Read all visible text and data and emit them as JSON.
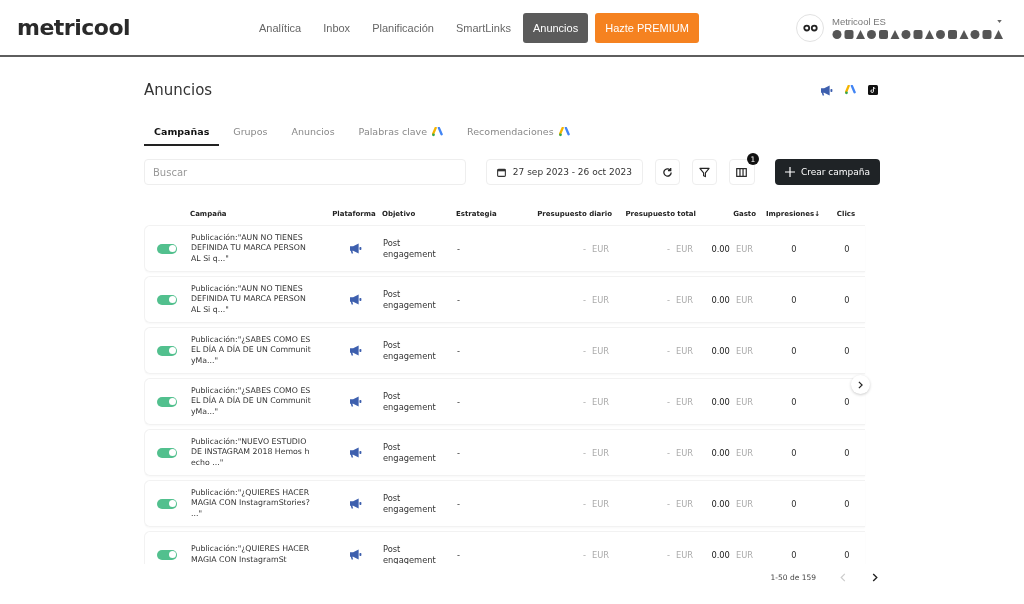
{
  "header": {
    "logo": "metricool",
    "nav": [
      {
        "label": "Analítica",
        "selected": false
      },
      {
        "label": "Inbox",
        "selected": false
      },
      {
        "label": "Planificación",
        "selected": false
      },
      {
        "label": "SmartLinks",
        "selected": false
      },
      {
        "label": "Anuncios",
        "selected": true
      }
    ],
    "premium": "Hazte PREMIUM",
    "account": {
      "name": "Metricool ES"
    }
  },
  "page": {
    "title": "Anuncios"
  },
  "tabs": [
    {
      "label": "Campañas",
      "selected": true,
      "ads_icon": false
    },
    {
      "label": "Grupos",
      "selected": false,
      "ads_icon": false
    },
    {
      "label": "Anuncios",
      "selected": false,
      "ads_icon": false
    },
    {
      "label": "Palabras clave",
      "selected": false,
      "ads_icon": true
    },
    {
      "label": "Recomendaciones",
      "selected": false,
      "ads_icon": true
    }
  ],
  "toolbar": {
    "search": {
      "placeholder": "Buscar"
    },
    "date_range": "27 sep 2023 - 26 oct 2023",
    "columns_badge": "1",
    "create_button": "Crear campaña"
  },
  "table": {
    "columns": [
      {
        "label": "Campaña"
      },
      {
        "label": "Plataforma"
      },
      {
        "label": "Objetivo"
      },
      {
        "label": "Estrategia"
      },
      {
        "label": "Presupuesto diario"
      },
      {
        "label": "Presupuesto total"
      },
      {
        "label": "Gasto"
      },
      {
        "label": "Impresiones↓"
      },
      {
        "label": "Clics"
      }
    ],
    "rows": [
      {
        "active": true,
        "campaign": "Publicación:\"AUN NO TIENES DEFINIDA TU MARCA PERSONAL Si q...\"",
        "objective": "Post engagement",
        "strategy": "-",
        "daily": "-",
        "daily_currency": "EUR",
        "total": "-",
        "total_currency": "EUR",
        "spend": "0.00",
        "spend_currency": "EUR",
        "impressions": "0",
        "clicks": "0"
      },
      {
        "active": true,
        "campaign": "Publicación:\"AUN NO TIENES DEFINIDA TU MARCA PERSONAL Si q...\"",
        "objective": "Post engagement",
        "strategy": "-",
        "daily": "-",
        "daily_currency": "EUR",
        "total": "-",
        "total_currency": "EUR",
        "spend": "0.00",
        "spend_currency": "EUR",
        "impressions": "0",
        "clicks": "0"
      },
      {
        "active": true,
        "campaign": "Publicación:\"¿SABES COMO ES EL DÍA A DÍA DE UN CommunityMa...\"",
        "objective": "Post engagement",
        "strategy": "-",
        "daily": "-",
        "daily_currency": "EUR",
        "total": "-",
        "total_currency": "EUR",
        "spend": "0.00",
        "spend_currency": "EUR",
        "impressions": "0",
        "clicks": "0"
      },
      {
        "active": true,
        "campaign": "Publicación:\"¿SABES COMO ES EL DÍA A DÍA DE UN CommunityMa...\"",
        "objective": "Post engagement",
        "strategy": "-",
        "daily": "-",
        "daily_currency": "EUR",
        "total": "-",
        "total_currency": "EUR",
        "spend": "0.00",
        "spend_currency": "EUR",
        "impressions": "0",
        "clicks": "0"
      },
      {
        "active": true,
        "campaign": "Publicación:\"NUEVO ESTUDIO DE INSTAGRAM 2018 Hemos hecho ...\"",
        "objective": "Post engagement",
        "strategy": "-",
        "daily": "-",
        "daily_currency": "EUR",
        "total": "-",
        "total_currency": "EUR",
        "spend": "0.00",
        "spend_currency": "EUR",
        "impressions": "0",
        "clicks": "0"
      },
      {
        "active": true,
        "campaign": "Publicación:\"¿QUIERES HACER MAGIA CON InstagramStories? ...\"",
        "objective": "Post engagement",
        "strategy": "-",
        "daily": "-",
        "daily_currency": "EUR",
        "total": "-",
        "total_currency": "EUR",
        "spend": "0.00",
        "spend_currency": "EUR",
        "impressions": "0",
        "clicks": "0"
      },
      {
        "active": true,
        "campaign": "Publicación:\"¿QUIERES HACER MAGIA CON InstagramSt",
        "objective": "Post engagement",
        "strategy": "-",
        "daily": "-",
        "daily_currency": "EUR",
        "total": "-",
        "total_currency": "EUR",
        "spend": "0.00",
        "spend_currency": "EUR",
        "impressions": "0",
        "clicks": "0"
      }
    ]
  },
  "pagination": {
    "range": "1-50 de 159",
    "prev_disabled": true
  }
}
